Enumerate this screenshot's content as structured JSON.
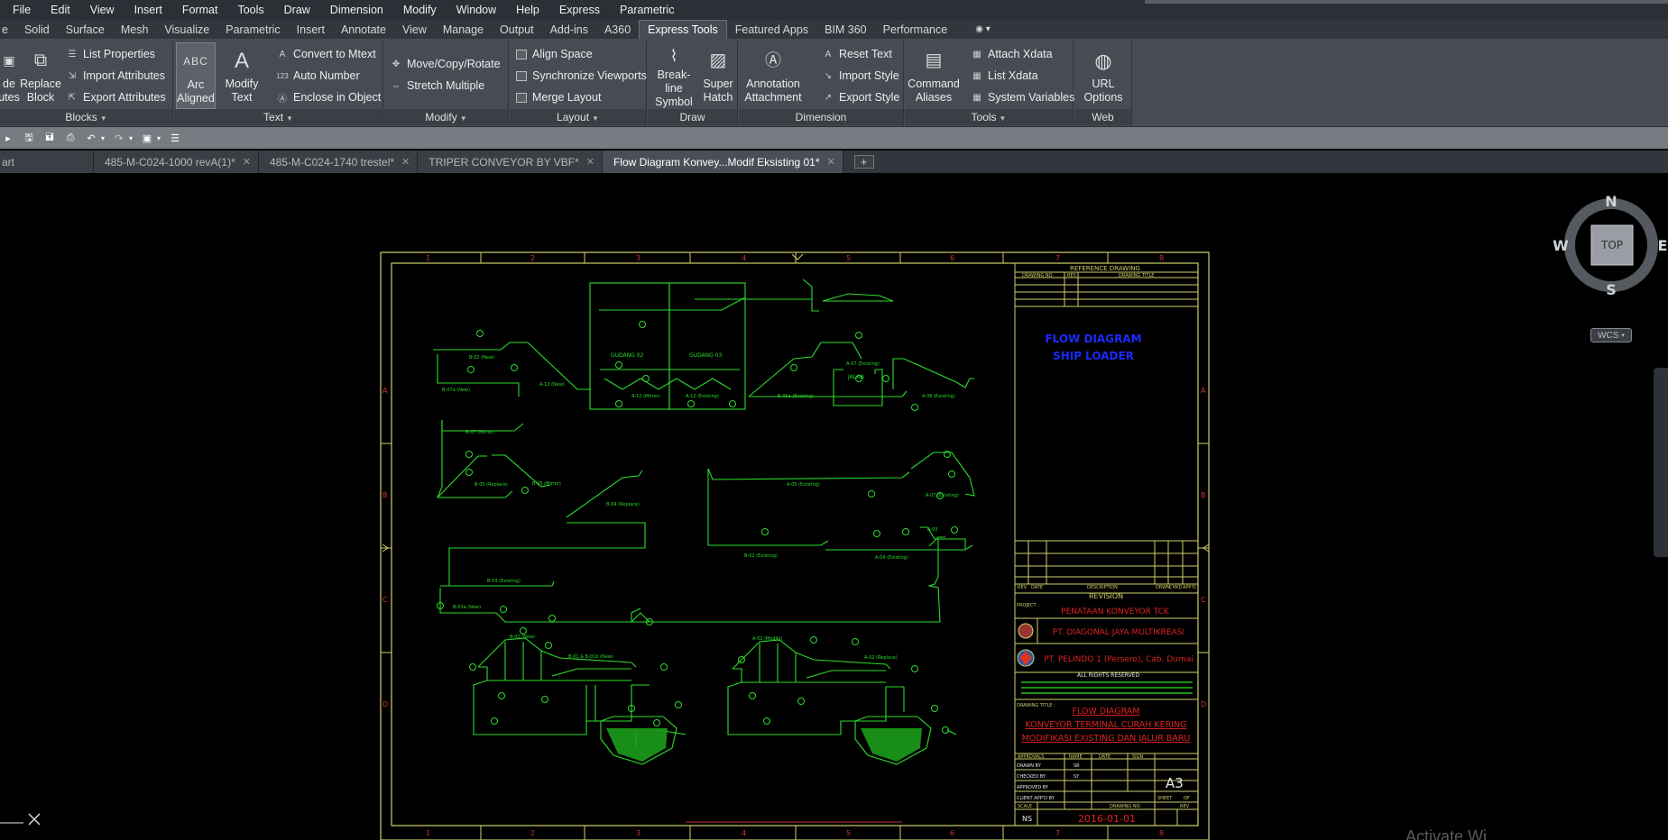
{
  "menubar": {
    "items": [
      "File",
      "Edit",
      "View",
      "Insert",
      "Format",
      "Tools",
      "Draw",
      "Dimension",
      "Modify",
      "Window",
      "Help",
      "Express",
      "Parametric"
    ]
  },
  "ribbon_tabs": {
    "items": [
      "e",
      "Solid",
      "Surface",
      "Mesh",
      "Visualize",
      "Parametric",
      "Insert",
      "Annotate",
      "View",
      "Manage",
      "Output",
      "Add-ins",
      "A360",
      "Express Tools",
      "Featured Apps",
      "BIM 360",
      "Performance"
    ],
    "active": "Express Tools",
    "extra": "◉ ▾"
  },
  "ribbon": {
    "blocks": {
      "title": "Blocks",
      "cut_label_1": "de",
      "cut_label_2": "utes",
      "replace_block": [
        "Replace",
        "Block"
      ],
      "list_properties": "List Properties",
      "import_attributes": "Import Attributes",
      "export_attributes": "Export Attributes"
    },
    "text": {
      "title": "Text",
      "arc_aligned": [
        "Arc",
        "Aligned"
      ],
      "modify_text": [
        "Modify",
        "Text"
      ],
      "convert_to_mtext": "Convert to Mtext",
      "auto_number": "Auto Number",
      "enclose_in_object": "Enclose in Object"
    },
    "modify": {
      "title": "Modify",
      "move_copy_rotate": "Move/Copy/Rotate",
      "stretch_multiple": "Stretch Multiple"
    },
    "layout": {
      "title": "Layout",
      "align_space": "Align Space",
      "synchronize_viewports": "Synchronize Viewports",
      "merge_layout": "Merge Layout"
    },
    "draw": {
      "title": "Draw",
      "break_line": [
        "Break-line",
        "Symbol"
      ],
      "super_hatch": [
        "Super",
        "Hatch"
      ]
    },
    "dimension": {
      "title": "Dimension",
      "annotation_attachment": [
        "Annotation",
        "Attachment"
      ],
      "reset_text": "Reset Text",
      "import_style": "Import Style",
      "export_style": "Export Style"
    },
    "tools": {
      "title": "Tools",
      "command_aliases": [
        "Command",
        "Aliases"
      ],
      "attach_xdata": "Attach Xdata",
      "list_xdata": "List Xdata",
      "system_variables": "System Variables"
    },
    "web": {
      "title": "Web",
      "url_options": [
        "URL",
        "Options"
      ]
    }
  },
  "doc_tabs": {
    "items": [
      {
        "label": "art",
        "close": false
      },
      {
        "label": "485-M-C024-1000 revA(1)*",
        "close": true
      },
      {
        "label": "485-M-C024-1740 trestel*",
        "close": true
      },
      {
        "label": "TRIPER CONVEYOR BY VBF*",
        "close": true
      },
      {
        "label": "Flow Diagram Konvey...Modif Eksisting 01*",
        "close": true,
        "active": true
      }
    ],
    "plus": "+"
  },
  "viewcube": {
    "top": "TOP",
    "n": "N",
    "s": "S",
    "e": "E",
    "w": "W"
  },
  "wcs": "WCS",
  "watermark": "Activate Wi",
  "drawing": {
    "ref_title": "REFERENCE DRAWING",
    "ref_cols": [
      "DRAWING NO.",
      "REV.",
      "DRAWING TITLE"
    ],
    "main_title_1": "FLOW DIAGRAM",
    "main_title_2": "SHIP LOADER",
    "revision": "REVISION",
    "rev_cols": [
      "REV.",
      "DATE",
      "DESCRIPTION",
      "DRWN",
      "CHKD",
      "APP'D"
    ],
    "project_label": "PROJECT :",
    "project": "PENATAAN KONVEYOR TCK",
    "company_1": "PT. DIAGONAL JAYA MULTIKREASI",
    "company_2": "PT. PELINDO 1 (Persero), Cab. Dumai",
    "rights": "ALL RIGHTS RESERVED",
    "drawing_title_label": "DRAWING TITLE :",
    "dt_1": "FLOW DIAGRAM",
    "dt_2": "KONVEYOR TERMINAL CURAH KERING",
    "dt_3": "MODIFIKASI EXISTING DAN JALUR BARU",
    "approvals": [
      "APPROVALS",
      "NAME",
      "DATE",
      "SIGN"
    ],
    "drawn_by": "DRAWN BY",
    "checked_by": "CHECKED BY",
    "approved_by": "APPROVED BY",
    "client_appd_by": "CLIENT APP'D BY",
    "sr": "SR",
    "sy": "SY",
    "size": "A3",
    "sheet": "SHEET",
    "of": "OF",
    "scale_label": "SCALE",
    "scale": "NS",
    "drawing_no_label": "DRAWING NO.",
    "drawing_no": "2016-01-01",
    "rev_label": "REV.",
    "gudang_1": "GUDANG 02",
    "gudang_2": "GUDANG 03",
    "jalan": "JALAN",
    "col_nums": [
      "1",
      "2",
      "3",
      "4",
      "5",
      "6",
      "7",
      "8"
    ],
    "row_letters": [
      "A",
      "B",
      "C",
      "D"
    ]
  }
}
